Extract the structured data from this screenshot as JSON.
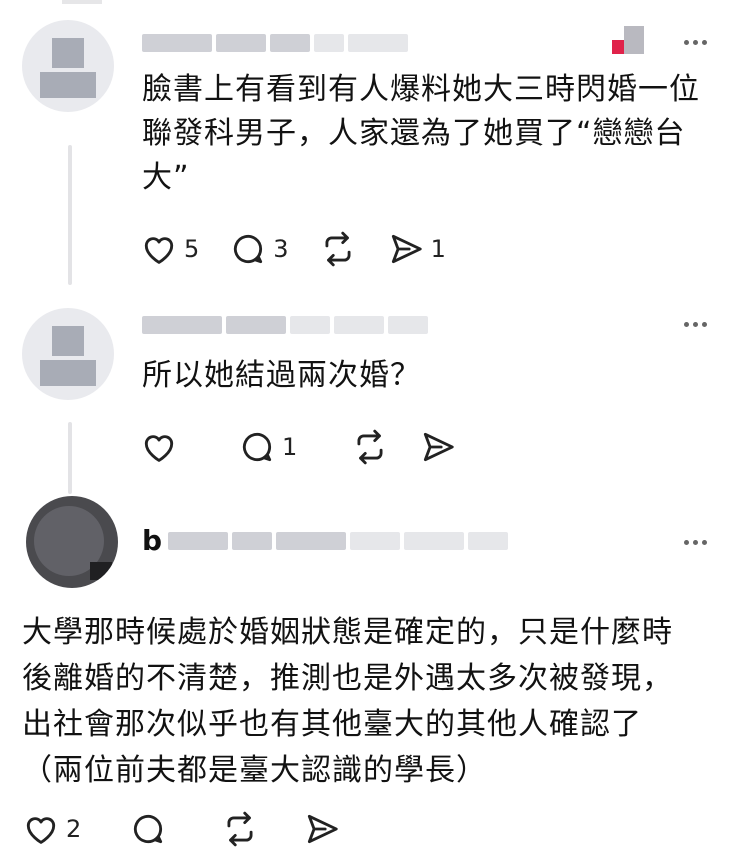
{
  "comments": [
    {
      "name_visible": "",
      "text": "臉書上有看到有人爆料她大三時閃婚一位\n聯發科男子，人家還為了她買了“戀戀台\n大”",
      "likes": "5",
      "replies": "3",
      "reposts": "",
      "shares": "1"
    },
    {
      "name_visible": "",
      "text": "所以她結過兩次婚？",
      "likes": "",
      "replies": "1",
      "reposts": "",
      "shares": ""
    },
    {
      "name_visible": "b",
      "text": "大學那時候處於婚姻狀態是確定的，只是什麼時\n後離婚的不清楚，推測也是外遇太多次被發現，\n出社會那次似乎也有其他臺大的其他人確認了\n（兩位前夫都是臺大認識的學長）",
      "likes": "2",
      "replies": "",
      "reposts": "",
      "shares": ""
    }
  ],
  "icons": [
    "heart-icon",
    "comment-icon",
    "repost-icon",
    "share-icon",
    "more-icon"
  ],
  "colors": {
    "text": "#121212",
    "icon": "#222222",
    "thread_line": "#e3e3e6",
    "badge_red": "#e0224a"
  }
}
